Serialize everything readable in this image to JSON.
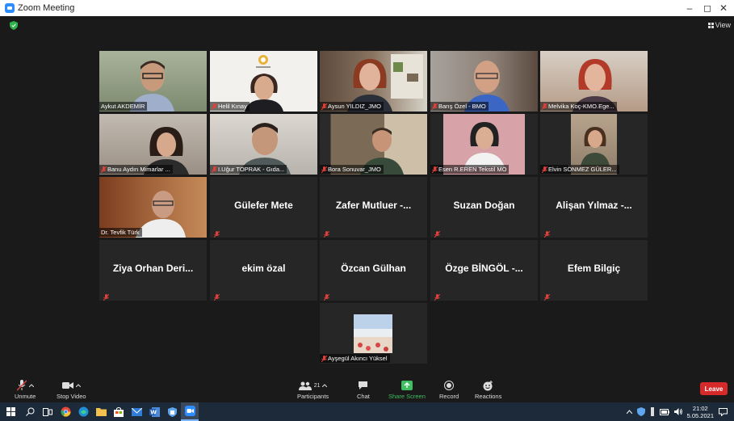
{
  "window": {
    "title": "Zoom Meeting",
    "controls": [
      "–",
      "◻",
      "✕"
    ]
  },
  "view_label": "View",
  "tiles": [
    {
      "name": "Aykut AKDEMİR",
      "type": "video",
      "muted": false,
      "bg": "#7c8a6f"
    },
    {
      "name": "Helil Kınay",
      "type": "video",
      "muted": true,
      "bg": "#e8e6e1"
    },
    {
      "name": "Aysun YILDIZ_JMO",
      "type": "video",
      "muted": true,
      "bg": "#6a5a4d"
    },
    {
      "name": "Barış Özel - BMO",
      "type": "video",
      "muted": true,
      "bg": "#8b7e74"
    },
    {
      "name": "Melvika Koç-KMO.Ege...",
      "type": "video",
      "muted": true,
      "bg": "#b59b86"
    },
    {
      "name": "Banu Aydın Mimarlar ...",
      "type": "video",
      "muted": true,
      "bg": "#9a8f84"
    },
    {
      "name": "I.Uğur TOPRAK - Gıda...",
      "type": "video",
      "muted": true,
      "bg": "#b7b3ac"
    },
    {
      "name": "Bora Sonuvar_JMO",
      "type": "video",
      "muted": true,
      "bg": "#7b6a55"
    },
    {
      "name": "Esen R.EREN Tekstil MO",
      "type": "video",
      "muted": true,
      "bg": "#d7a3a8"
    },
    {
      "name": "Elvin SÖNMEZ GÜLER...",
      "type": "video",
      "muted": true,
      "bg": "#8e7d6a"
    },
    {
      "name": "Dr. Tevfik Türk",
      "type": "video",
      "muted": false,
      "active": true,
      "bg": "#a0623a"
    },
    {
      "name": "Gülefer Mete",
      "type": "name",
      "muted": true
    },
    {
      "name": "Zafer Mutluer -...",
      "type": "name",
      "muted": true
    },
    {
      "name": "Suzan Doğan",
      "type": "name",
      "muted": true
    },
    {
      "name": "Alişan Yılmaz -...",
      "type": "name",
      "muted": true
    },
    {
      "name": "Ziya Orhan Deri...",
      "type": "name",
      "muted": true
    },
    {
      "name": "ekim özal",
      "type": "name",
      "muted": true
    },
    {
      "name": "Özcan Gülhan",
      "type": "name",
      "muted": true
    },
    {
      "name": "Özge BİNGÖL -...",
      "type": "name",
      "muted": true
    },
    {
      "name": "Efem Bilgiç",
      "type": "name",
      "muted": true
    },
    {
      "name": "Ayşegül Akıncı Yüksel",
      "type": "picture",
      "muted": true,
      "bg": "#c9d7e6"
    }
  ],
  "toolbar": {
    "unmute": "Unmute",
    "stop_video": "Stop Video",
    "participants": "Participants",
    "participants_count": "21",
    "chat": "Chat",
    "share_screen": "Share Screen",
    "record": "Record",
    "reactions": "Reactions",
    "leave": "Leave"
  },
  "taskbar": {
    "time": "21:02",
    "date": "5.05.2021"
  },
  "colors": {
    "accent": "#2d8cff",
    "share_green": "#3fbf62",
    "leave_red": "#d62a2a",
    "active_speaker": "#d8e64b"
  }
}
